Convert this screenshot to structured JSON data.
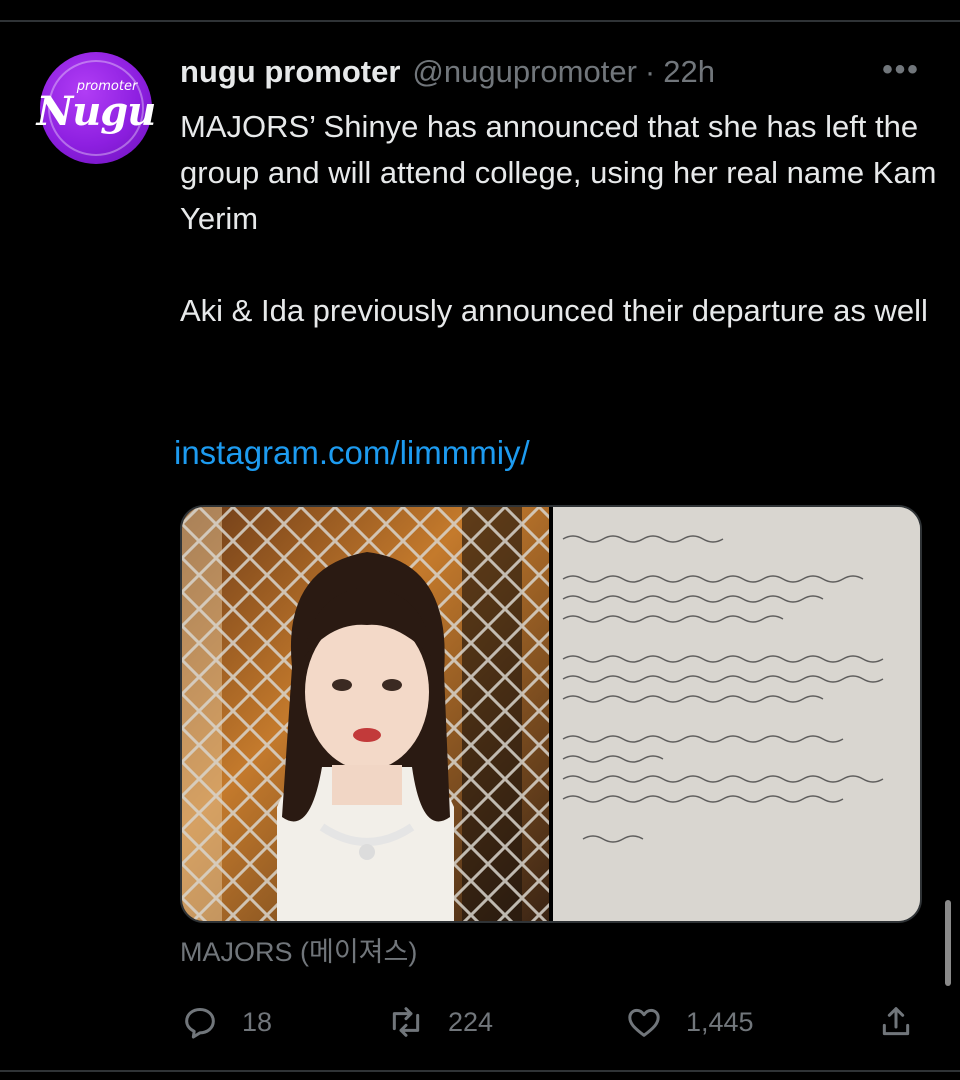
{
  "tweet": {
    "display_name": "nugu promoter",
    "handle": "@nugupromoter",
    "separator": "·",
    "time": "22h",
    "more": "•••",
    "text": "MAJORS’ Shinye has announced that she has left the group and will attend college, using her real name Kam Yerim\n\nAki & Ida previously announced their departure as well",
    "link": "instagram.com/limmmiy/",
    "avatar": {
      "small_text": "promoter",
      "big_text": "Nugu",
      "color": "#8d1fe0"
    },
    "media_caption": "MAJORS (메이져스)",
    "stats": {
      "replies": "18",
      "retweets": "224",
      "likes": "1,445"
    }
  },
  "icons": {
    "reply": "comment-bubble-icon",
    "retweet": "retweet-icon",
    "like": "heart-icon",
    "share": "share-upload-icon"
  },
  "colors": {
    "background": "#000000",
    "text": "#e7e9ea",
    "muted": "#71767b",
    "link": "#1d9bf0",
    "divider": "#2f3336"
  }
}
